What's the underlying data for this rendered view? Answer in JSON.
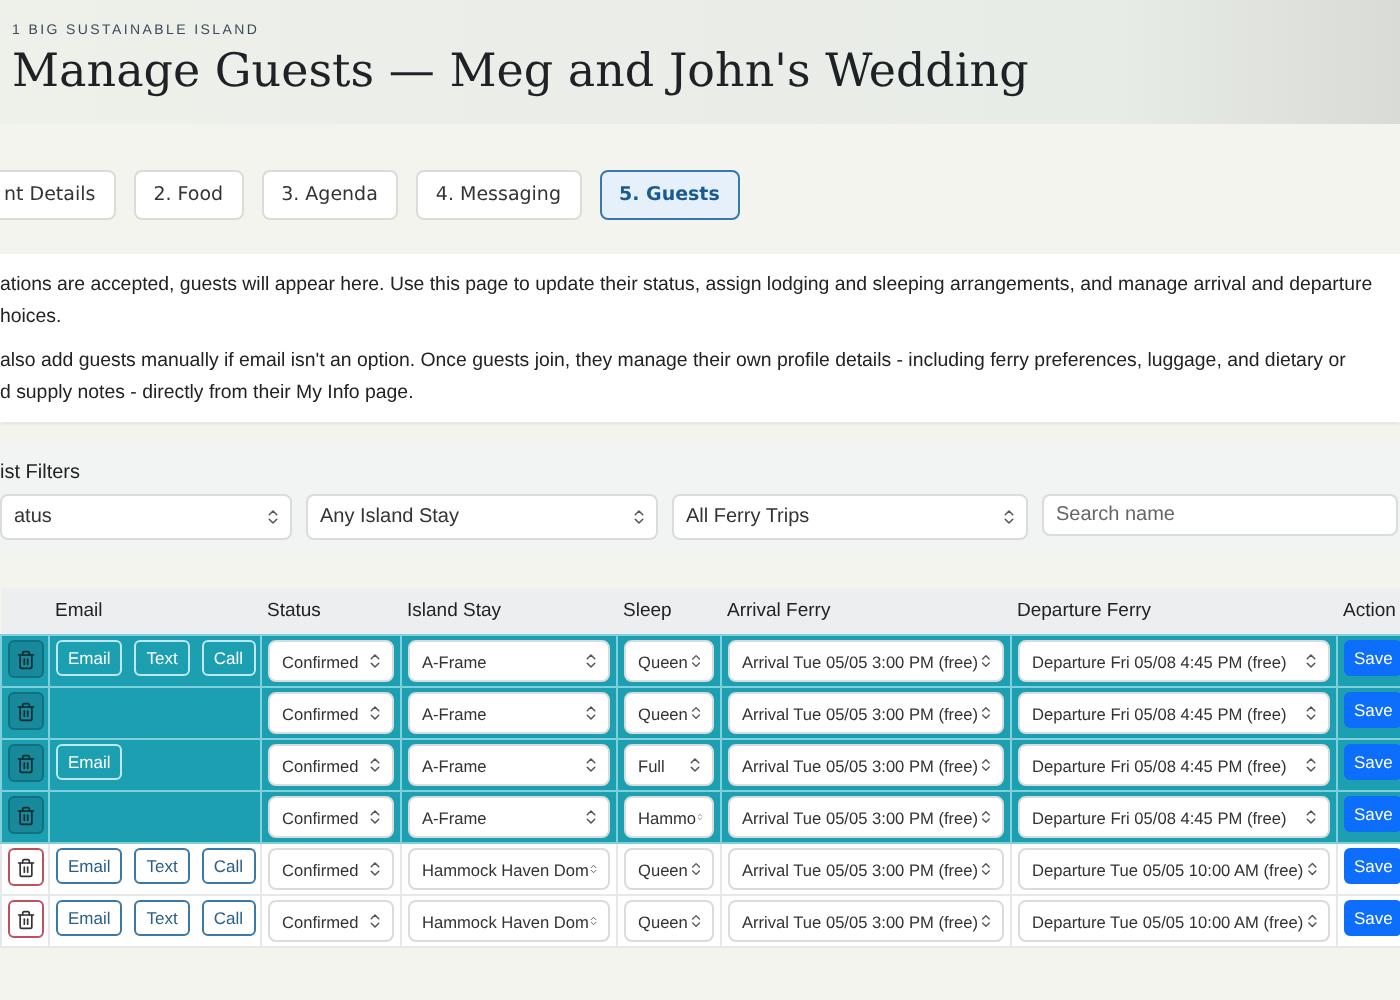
{
  "header": {
    "eyebrow": "1 BIG SUSTAINABLE ISLAND",
    "title": "Manage Guests — Meg and John's Wedding"
  },
  "tabs": [
    {
      "label": "nt Details",
      "selected": false
    },
    {
      "label": "2. Food",
      "selected": false
    },
    {
      "label": "3. Agenda",
      "selected": false
    },
    {
      "label": "4. Messaging",
      "selected": false
    },
    {
      "label": "5. Guests",
      "selected": true
    }
  ],
  "intro": [
    [
      "ations are accepted, guests will appear here. Use this page to update their status, assign lodging and sleeping arrangements, and manage arrival and departure",
      "hoices."
    ],
    [
      "also add guests manually if email isn't an option. Once guests join, they manage their own profile details - including ferry preferences, luggage, and dietary or",
      "d supply notes - directly from their My Info page."
    ]
  ],
  "filters": {
    "label": "ist Filters",
    "selects": [
      "atus",
      "Any Island Stay",
      "All Ferry Trips"
    ],
    "search": {
      "placeholder": "Search name"
    }
  },
  "table": {
    "columns": [
      "Email",
      "Status",
      "Island Stay",
      "Sleep",
      "Arrival Ferry",
      "Departure Ferry",
      "Action"
    ],
    "rows": [
      {
        "selected": true,
        "contacts": [
          "Email",
          "Text",
          "Call"
        ],
        "status": "Confirmed",
        "stay": "A-Frame",
        "sleep": "Queen",
        "arrival": "Arrival Tue 05/05 3:00 PM (free)",
        "departure": "Departure Fri 05/08 4:45 PM (free)",
        "action": "Save"
      },
      {
        "selected": true,
        "contacts": [],
        "status": "Confirmed",
        "stay": "A-Frame",
        "sleep": "Queen",
        "arrival": "Arrival Tue 05/05 3:00 PM (free)",
        "departure": "Departure Fri 05/08 4:45 PM (free)",
        "action": "Save"
      },
      {
        "selected": true,
        "contacts": [
          "Email"
        ],
        "status": "Confirmed",
        "stay": "A-Frame",
        "sleep": "Full",
        "arrival": "Arrival Tue 05/05 3:00 PM (free)",
        "departure": "Departure Fri 05/08 4:45 PM (free)",
        "action": "Save"
      },
      {
        "selected": true,
        "contacts": [],
        "status": "Confirmed",
        "stay": "A-Frame",
        "sleep": "Hammo",
        "arrival": "Arrival Tue 05/05 3:00 PM (free)",
        "departure": "Departure Fri 05/08 4:45 PM (free)",
        "action": "Save"
      },
      {
        "selected": false,
        "contacts": [
          "Email",
          "Text",
          "Call"
        ],
        "status": "Confirmed",
        "stay": "Hammock Haven Dom",
        "sleep": "Queen",
        "arrival": "Arrival Tue 05/05 3:00 PM (free)",
        "departure": "Departure Tue 05/05 10:00 AM (free)",
        "action": "Save"
      },
      {
        "selected": false,
        "contacts": [
          "Email",
          "Text",
          "Call"
        ],
        "status": "Confirmed",
        "stay": "Hammock Haven Dom",
        "sleep": "Queen",
        "arrival": "Arrival Tue 05/05 3:00 PM (free)",
        "departure": "Departure Tue 05/05 10:00 AM (free)",
        "action": "Save"
      }
    ]
  }
}
